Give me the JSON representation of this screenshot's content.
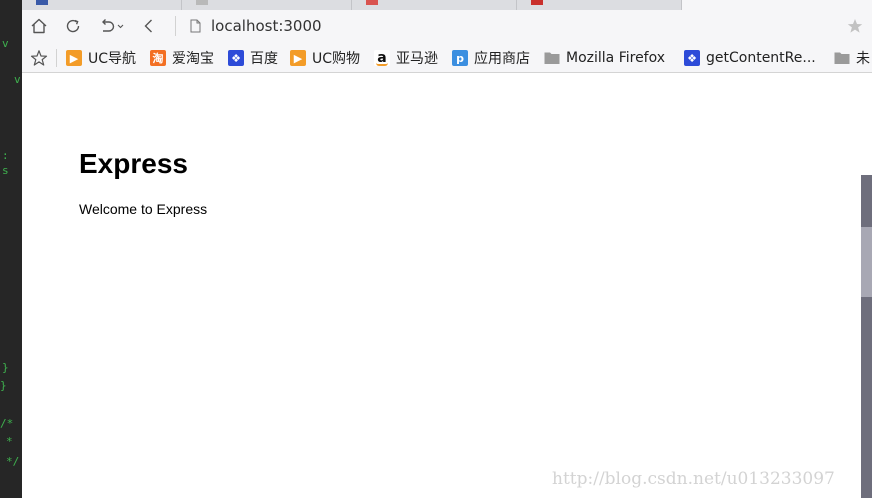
{
  "browser": {
    "address": "localhost:3000"
  },
  "bookmarks": [
    {
      "label": "UC导航",
      "icon": "uc-icon",
      "color": "#f39c28",
      "glyph": "▶"
    },
    {
      "label": "爱淘宝",
      "icon": "taobao-icon",
      "color": "#f36f23",
      "glyph": "淘"
    },
    {
      "label": "百度",
      "icon": "baidu-paw-icon",
      "color": "#2d4bd8",
      "glyph": "❖"
    },
    {
      "label": "UC购物",
      "icon": "uc-icon",
      "color": "#f39c28",
      "glyph": "▶"
    },
    {
      "label": "亚马逊",
      "icon": "amazon-icon",
      "color": "#ffffff",
      "glyph": "a"
    },
    {
      "label": "应用商店",
      "icon": "app-store-icon",
      "color": "#3c8fe0",
      "glyph": "p"
    },
    {
      "label": "Mozilla Firefox",
      "icon": "folder-icon",
      "color": "#9a9a9a",
      "glyph": ""
    },
    {
      "label": "getContentRe...",
      "icon": "baidu-paw-icon",
      "color": "#2d4bd8",
      "glyph": "❖"
    },
    {
      "label": "未",
      "icon": "folder-icon",
      "color": "#9a9a9a",
      "glyph": ""
    }
  ],
  "page": {
    "heading": "Express",
    "welcome": "Welcome to Express"
  },
  "watermark": "http://blog.csdn.net/u013233097",
  "colors": {
    "editor_bg": "#262626",
    "editor_text": "#3fb34f",
    "toolbar_bg": "#f6f6f8",
    "tabstrip_bg": "#dcdde1",
    "scrollbar": "#6e6e7c"
  }
}
